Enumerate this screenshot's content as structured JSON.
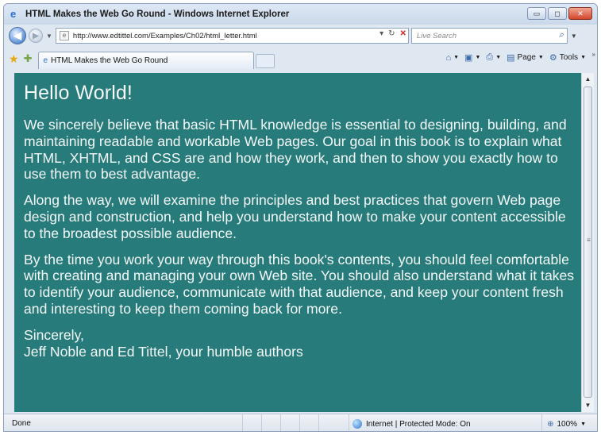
{
  "window": {
    "title": "HTML Makes the Web Go Round - Windows Internet Explorer",
    "buttons": {
      "minimize": "▭",
      "maximize": "◻",
      "close": "✕"
    }
  },
  "navigation": {
    "back_glyph": "◀",
    "forward_glyph": "▶",
    "address": "http://www.edtittel.com/Examples/Ch02/html_letter.html",
    "search_placeholder": "Live Search"
  },
  "tabs": [
    {
      "label": "HTML Makes the Web Go Round"
    }
  ],
  "commandbar": {
    "page_label": "Page",
    "tools_label": "Tools"
  },
  "page": {
    "heading": "Hello World!",
    "paragraphs": [
      "We sincerely believe that basic HTML knowledge is essential to designing, building, and maintaining readable and workable Web pages. Our goal in this book is to explain what HTML, XHTML, and CSS are and how they work, and then to show you exactly how to use them to best advantage.",
      "Along the way, we will examine the principles and best practices that govern Web page design and construction, and help you understand how to make your content accessible to the broadest possible audience.",
      "By the time you work your way through this book's contents, you should feel comfortable with creating and managing your own Web site. You should also understand what it takes to identify your audience, communicate with that audience, and keep your content fresh and interesting to keep them coming back for more."
    ],
    "closing": "Sincerely,",
    "signature": "Jeff Noble and Ed Tittel, your humble authors",
    "background_color": "#287b7b"
  },
  "statusbar": {
    "status": "Done",
    "zone": "Internet | Protected Mode: On",
    "zoom": "100%"
  }
}
